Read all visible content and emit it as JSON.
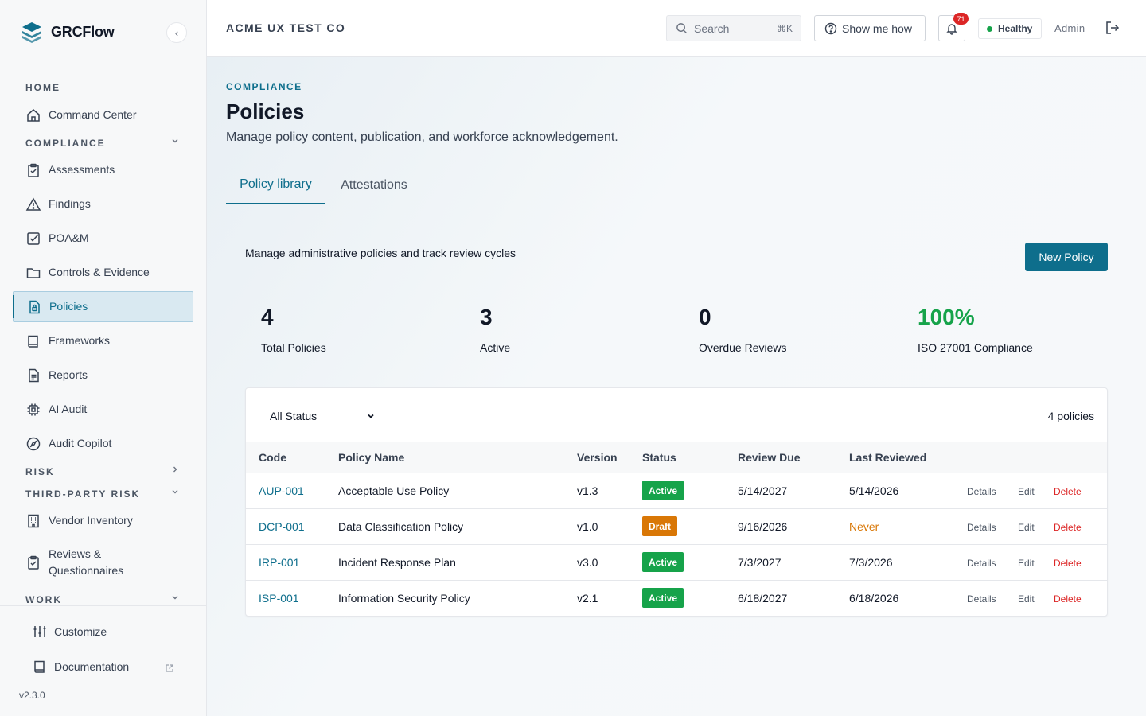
{
  "brand": {
    "name": "GRCFlow"
  },
  "org_name": "ACME UX TEST CO",
  "search": {
    "label": "Search",
    "shortcut": "⌘K"
  },
  "help_button": "Show me how",
  "notifications": {
    "count": "71"
  },
  "health": {
    "label": "Healthy",
    "color": "#16a34a"
  },
  "user": "Admin",
  "nav": {
    "home_section": "HOME",
    "command_center": "Command Center",
    "compliance_section": "COMPLIANCE",
    "assessments": "Assessments",
    "findings": "Findings",
    "poam": "POA&M",
    "controls": "Controls & Evidence",
    "policies": "Policies",
    "frameworks": "Frameworks",
    "reports": "Reports",
    "ai_audit": "AI Audit",
    "audit_copilot": "Audit Copilot",
    "risk_section": "RISK",
    "third_party_section": "THIRD-PARTY RISK",
    "vendor_inventory": "Vendor Inventory",
    "reviews": "Reviews & Questionnaires",
    "work_section": "WORK"
  },
  "footer": {
    "customize": "Customize",
    "documentation": "Documentation",
    "version": "v2.3.0"
  },
  "page": {
    "eyebrow": "COMPLIANCE",
    "title": "Policies",
    "subtitle": "Manage policy content, publication, and workforce acknowledgement."
  },
  "tabs": [
    {
      "label": "Policy library",
      "active": true
    },
    {
      "label": "Attestations",
      "active": false
    }
  ],
  "library": {
    "description": "Manage administrative policies and track review cycles",
    "new_button": "New Policy"
  },
  "stats": [
    {
      "value": "4",
      "label": "Total Policies"
    },
    {
      "value": "3",
      "label": "Active"
    },
    {
      "value": "0",
      "label": "Overdue Reviews"
    },
    {
      "value": "100%",
      "label": "ISO 27001 Compliance"
    }
  ],
  "filter": {
    "selected": "All Status"
  },
  "policy_count": "4 policies",
  "table": {
    "headers": [
      "Code",
      "Policy Name",
      "Version",
      "Status",
      "Review Due",
      "Last Reviewed"
    ],
    "actions": {
      "details": "Details",
      "edit": "Edit",
      "delete": "Delete"
    },
    "rows": [
      {
        "code": "AUP-001",
        "name": "Acceptable Use Policy",
        "version": "v1.3",
        "status": "Active",
        "review_due": "5/14/2027",
        "last_reviewed": "5/14/2026"
      },
      {
        "code": "DCP-001",
        "name": "Data Classification Policy",
        "version": "v1.0",
        "status": "Draft",
        "review_due": "9/16/2026",
        "last_reviewed": "Never"
      },
      {
        "code": "IRP-001",
        "name": "Incident Response Plan",
        "version": "v3.0",
        "status": "Active",
        "review_due": "7/3/2027",
        "last_reviewed": "7/3/2026"
      },
      {
        "code": "ISP-001",
        "name": "Information Security Policy",
        "version": "v2.1",
        "status": "Active",
        "review_due": "6/18/2027",
        "last_reviewed": "6/18/2026"
      }
    ]
  },
  "colors": {
    "accent": "#0e6e8c",
    "success": "#16a34a",
    "warning": "#d97706",
    "danger": "#dc2626"
  }
}
